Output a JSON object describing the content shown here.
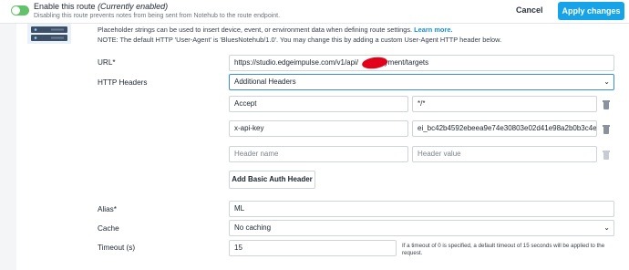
{
  "route": {
    "enable_label": "Enable this route",
    "enable_status": "(Currently enabled)",
    "enable_description": "Disabling this route prevents notes from being sent from Notehub to the route endpoint.",
    "cancel_label": "Cancel",
    "apply_label": "Apply changes"
  },
  "intro": {
    "line1": "Placeholder strings can be used to insert device, event, or environment data when defining route settings.",
    "learn_more": "Learn more.",
    "line2": "NOTE: The default HTTP 'User-Agent' is 'BluesNotehub/1.0'. You may change this by adding a custom User-Agent HTTP header below."
  },
  "url": {
    "label": "URL*",
    "value_prefix": "https://studio.edgeimpulse.com/v1/api/",
    "value_suffix": "deployment/targets"
  },
  "http_headers": {
    "label": "HTTP Headers",
    "selected": "Additional Headers",
    "rows": [
      {
        "name": "Accept",
        "value": "*/*"
      },
      {
        "name": "x-api-key",
        "value": "ei_bc42b4592ebeea9e74e30803e02d41e98a2b0b3c4e"
      }
    ],
    "name_placeholder": "Header name",
    "value_placeholder": "Header value",
    "add_auth_label": "Add Basic Auth Header"
  },
  "alias": {
    "label": "Alias*",
    "value": "ML"
  },
  "cache": {
    "label": "Cache",
    "selected": "No caching"
  },
  "timeout": {
    "label": "Timeout (s)",
    "value": "15",
    "note_line1": "If a timeout of 0 is specified, a default timeout of 15 seconds will be applied to the",
    "note_line2": "request."
  },
  "colors": {
    "accent": "#17a3e8",
    "toggle_on": "#62c16b",
    "link": "#1591d1"
  }
}
